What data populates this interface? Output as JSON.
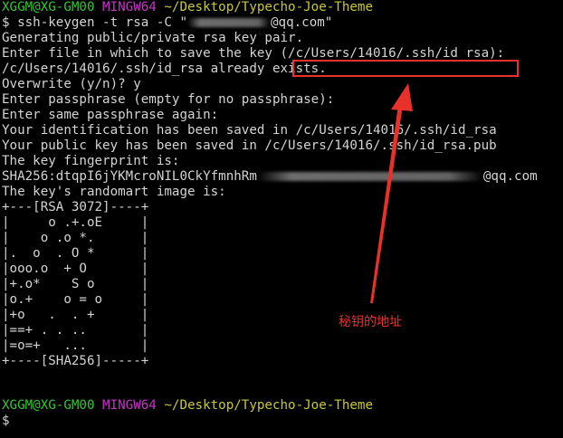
{
  "prompt1": {
    "user": "XGGM@XG-GM00",
    "sys": "MINGW64",
    "path": "~/Desktop/Typecho-Joe-Theme"
  },
  "cmd": {
    "prefix": "$ ssh-keygen -t rsa -C \"",
    "suffix": "@qq.com\""
  },
  "lines": [
    "Generating public/private rsa key pair.",
    "Enter file in which to save the key (/c/Users/14016/.ssh/id_rsa):",
    "/c/Users/14016/.ssh/id_rsa already exists.",
    "Overwrite (y/n)? y",
    "Enter passphrase (empty for no passphrase):",
    "Enter same passphrase again:",
    "Your identification has been saved in /c/Users/14016/.ssh/id_rsa",
    "Your public key has been saved in /c/Users/14016/.ssh/id_rsa.pub",
    "The key fingerprint is:"
  ],
  "fingerprint": {
    "prefix": "SHA256:dtqpI6jYKMcroNIL0CkYfmnhRm",
    "suffix": "@qq.com"
  },
  "randomart_title": "The key's randomart image is:",
  "art": [
    "+---[RSA 3072]----+",
    "|     o .+.oE     |",
    "|    o .o *.      |",
    "|.  o  . O *      |",
    "|ooo.o  + O       |",
    "|+.o*    S o      |",
    "|o.+    o = o     |",
    "|+o   .  . +      |",
    "|==+ . . ..       |",
    "|=o=+   ...       |",
    "+----[SHA256]-----+"
  ],
  "prompt2": {
    "user": "XGGM@XG-GM00",
    "sys": "MINGW64",
    "path": "~/Desktop/Typecho-Joe-Theme"
  },
  "cursor_prompt": "$",
  "annotation": "秘钥的地址",
  "colors": {
    "background": "#000000",
    "text": "#d3d3d3",
    "user": "#32c832",
    "system": "#c832c8",
    "path": "#c8c832",
    "annotation": "#e8312a"
  }
}
